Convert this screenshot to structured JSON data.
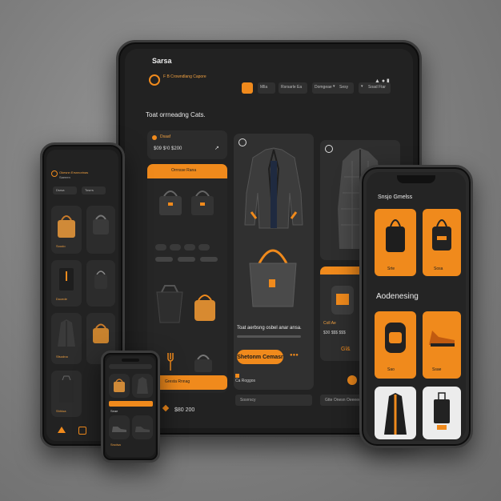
{
  "tablet": {
    "brand": "Sarsa",
    "status_time": "▲ ● ▮",
    "header": {
      "logo_text": "F B  Crowndlang  Capore",
      "menu_items": [
        "Mlla",
        "Rsrsarle Ea",
        "Domgeae",
        "Sesy",
        "Soad Ftar"
      ]
    },
    "section_title": "Toat orrneadng Cats.",
    "promo": {
      "label": "Dsaaf",
      "price": "$09 $¹0 $200"
    },
    "tag_label": "Orrnsse Rana",
    "product_caption": "Toat aerbsng osbel anar  ansa.",
    "cta_label": "Shetonm Cemasr",
    "side_caption": "Coll Ae",
    "side_badge": "Gl&",
    "side_price": "$30 $$$ $$$",
    "shop_button": "Gresta Rnnag",
    "price_bottom": "$80 200",
    "bottom_link": "Ca Roggos",
    "bottom_rows": [
      "Sosrrscy",
      "Gtte Onesn Oeeeeee"
    ]
  },
  "phone_left": {
    "header": "Okesnn Ersnnorinas",
    "sub": "Saeeen",
    "tabs": [
      "Dsrsa",
      "Tosrrs"
    ],
    "labels": [
      "Soodo",
      "Docede",
      "Sfsodna",
      "Shhloa"
    ]
  },
  "phone_small": {
    "labels": [
      "Seae",
      "Srodsa"
    ]
  },
  "phone_right": {
    "section1": "Snsjo Gmelss",
    "section2": "Aodenesing",
    "tags": [
      "Srte",
      "Sosa",
      "Sao",
      "Ssae"
    ]
  },
  "colors": {
    "accent": "#f08a1c",
    "frame": "#1b1b1b",
    "card": "#2c2c2c",
    "background": "#7e7e7e"
  }
}
